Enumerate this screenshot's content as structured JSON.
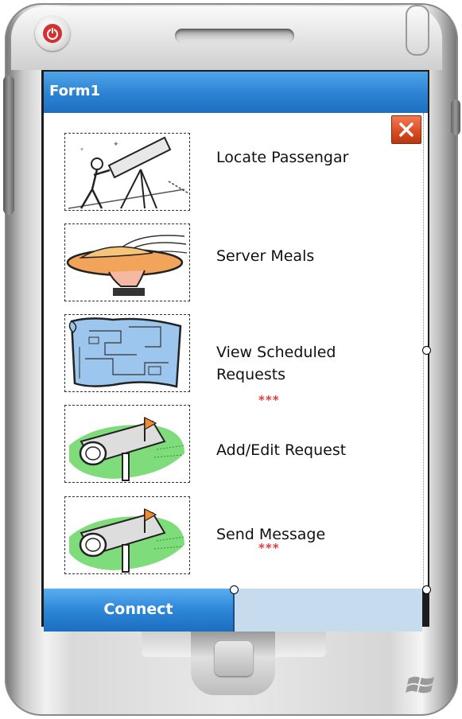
{
  "window": {
    "title": "Form1"
  },
  "menu": {
    "items": [
      {
        "label": "Locate Passengar",
        "icon": "telescope-icon"
      },
      {
        "label": "Server Meals",
        "icon": "meal-tray-icon"
      },
      {
        "label": "View Scheduled\nRequests",
        "icon": "map-icon"
      },
      {
        "label": "Add/Edit Request",
        "icon": "mailbox-icon"
      },
      {
        "label": "Send Message",
        "icon": "mailbox-icon"
      }
    ],
    "indicators": [
      "***",
      "***"
    ]
  },
  "taskbar": {
    "connect_label": "Connect"
  },
  "colors": {
    "titlebar": "#2b82d2",
    "close": "#d94b20",
    "indicator": "#e53a3a",
    "taskbar": "#c6dcee"
  }
}
